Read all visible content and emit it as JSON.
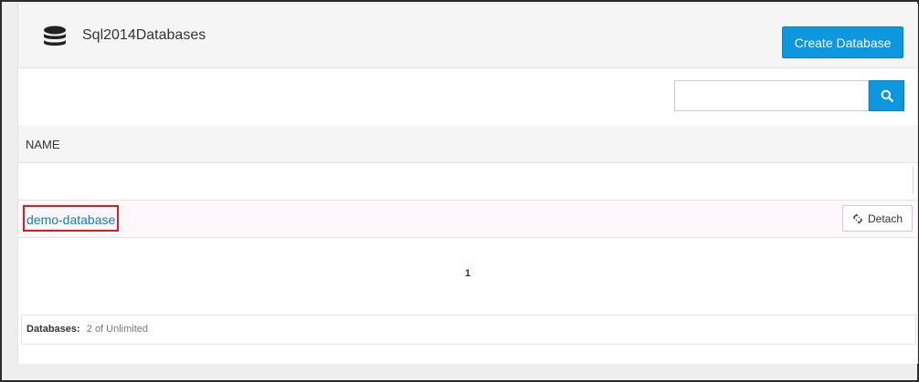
{
  "header": {
    "icon": "database-icon",
    "title": "Sql2014Databases",
    "create_label": "Create Database"
  },
  "search": {
    "value": "",
    "placeholder": "",
    "icon": "search-icon"
  },
  "table": {
    "columns": [
      "NAME"
    ],
    "rows": [
      {
        "name": "demo-database",
        "action_label": "Detach",
        "action_icon": "detach-link-icon"
      }
    ]
  },
  "pagination": {
    "current_page": "1"
  },
  "footer": {
    "label": "Databases:",
    "value": "2 of Unlimited"
  },
  "colors": {
    "accent": "#0c97de",
    "link": "#0c7cc4",
    "highlight_border": "#d62020"
  }
}
